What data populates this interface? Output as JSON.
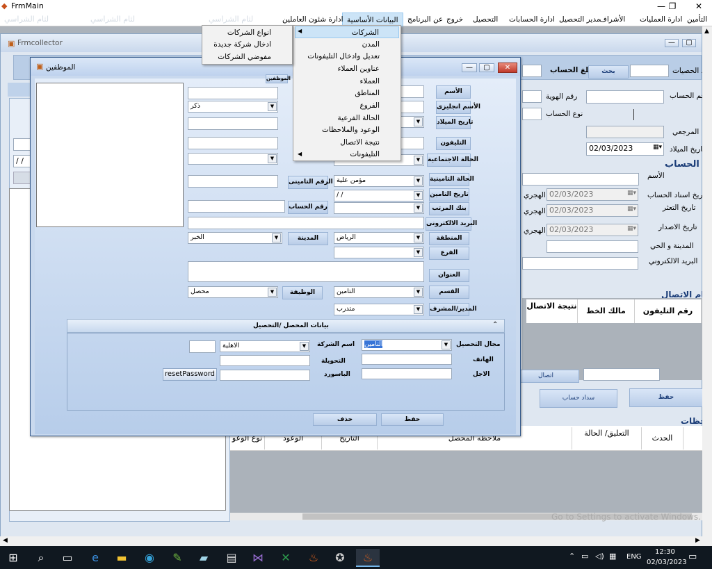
{
  "window": {
    "title": "FrmMain",
    "minimize": "—",
    "restore": "❐",
    "close": "✕"
  },
  "menu": [
    "التأمين",
    "ادارة العمليات",
    "الأشراف",
    "مدير التحصيل",
    "ادارة الحسابات",
    "التحصيل",
    "خروج",
    "عن البرنامج",
    "البيانات الأساسية",
    "ادارة شئون العاملين"
  ],
  "menu_left_shadow": "لثام الشراسي",
  "dropdown_main": [
    "الشركات",
    "المدن",
    "تعديل وادخال التليفونات",
    "عناوين العملاء",
    "العملاء",
    "المناطق",
    "الفروع",
    "الحالة الفرعية",
    "الوعود والملاحظات",
    "نتيجة الاتصال",
    "التليفونات"
  ],
  "dropdown_sub": [
    "انواع الشركات",
    "ادخال شركة جديدة",
    "مفوضي الشركات"
  ],
  "collector": {
    "title": "Frmcollector",
    "search_button": "بحث",
    "amount_label": "مبلغ الحساب",
    "count_label": "د الحصيات",
    "account_no_label": "رقم الحساب",
    "id_no_label": "رقم الهوية",
    "account_type_label": "نوع الحساب",
    "reference_label": "المرجعي",
    "birth_label": "تاريخ الميلاد",
    "birth_value": "02/03/2023",
    "section_account": "بيانات الحساب",
    "name_label": "الأسم",
    "assign_date_label": "تاريخ اسناد الحساب",
    "assign_date": "02/03/2023",
    "late_date_label": "تاريخ التعثر",
    "late_date": "02/03/2023",
    "issue_date_label": "تاريخ الاصدار",
    "issue_date": "02/03/2023",
    "hijri": "الهجري",
    "city_label": "المدينة و الحي",
    "email_label": "البريد الالكتروني",
    "section_phones": "رقام الاتصال",
    "phone_cols": [
      "رقم التليفون",
      "مالك الخط",
      "نتيجة الاتصال"
    ],
    "contact_button": "اتصال",
    "save_button": "حفظ",
    "pay_button": "سداد حساب",
    "section_actions": "حظات",
    "action_cols": [
      "الحدث",
      "التعليق/ الحالة",
      "ملاحظه المحصل",
      "التاريخ",
      "الوعود",
      "نوع الوعو"
    ],
    "left_date": "/ /",
    "watermark": "Go to Settings to activate Windows."
  },
  "emp": {
    "title": "الموظفين",
    "tab": "الموظفين",
    "name": "الأسم",
    "name_en": "الأسم انجليزى",
    "birth": "تاريخ الميلاد",
    "phone": "التليفون",
    "social": "الحالة الاجتماعية",
    "insurance_status": "الحالة التامينية",
    "insurance_status_value": "مؤمن علية",
    "insurance_date": "تاريخ التامين",
    "insurance_date_value": "/ /",
    "salary_bank": "بنك المرتب",
    "email": "البريد الالكترونى",
    "region": "المنطقة",
    "region_value": "الرياض",
    "branch": "الفرع",
    "address": "العنوان",
    "dept": "القسم",
    "dept_value": "التامين",
    "manager": "المدير/المشرف",
    "manager_value": "متدرب",
    "gender_value": "ذكر",
    "insurance_no": "الرقم التامينى",
    "account_no": "رقم الحساب",
    "city": "المدينة",
    "city_value": "الخبر",
    "job": "الوظيفة",
    "job_value": "محصل",
    "collector_group": "بيانات المحصل /التحصيل",
    "collection_field": "مجال التحصيل",
    "collection_field_value": "التامين",
    "company_name": "اسم الشركة",
    "company_value": "الاهلية",
    "phone2": "الهاتف",
    "extension": "التحويلة",
    "password": "الباسورد",
    "mobile": "الاجل",
    "reset_button": "resetPassword",
    "save": "حفظ",
    "delete": "حذف"
  },
  "taskbar": {
    "lang": "ENG",
    "time": "12:30",
    "date": "02/03/2023"
  }
}
